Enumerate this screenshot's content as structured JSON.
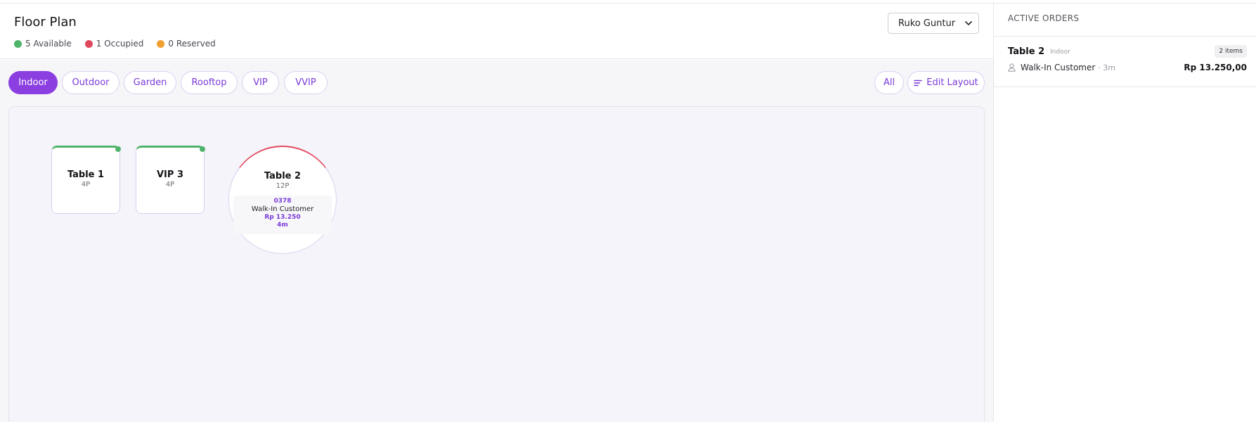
{
  "header": {
    "title": "Floor Plan",
    "legend": [
      {
        "label": "5 Available",
        "color": "#4fb46a"
      },
      {
        "label": "1 Occupied",
        "color": "#e0475d"
      },
      {
        "label": "0 Reserved",
        "color": "#f0a030"
      }
    ],
    "outlet": {
      "selected": "Ruko Guntur"
    }
  },
  "areas": {
    "tabs": [
      {
        "label": "Indoor",
        "active": true
      },
      {
        "label": "Outdoor",
        "active": false
      },
      {
        "label": "Garden",
        "active": false
      },
      {
        "label": "Rooftop",
        "active": false
      },
      {
        "label": "VIP",
        "active": false
      },
      {
        "label": "VVIP",
        "active": false
      }
    ],
    "all_label": "All",
    "edit_label": "Edit Layout"
  },
  "tables": [
    {
      "name": "Table 1",
      "capacity": "4P",
      "status": "available"
    },
    {
      "name": "VIP 3",
      "capacity": "4P",
      "status": "available"
    },
    {
      "name": "Table 2",
      "capacity": "12P",
      "status": "occupied",
      "order": {
        "code": "0378",
        "customer": "Walk-In Customer",
        "amount": "Rp 13.250",
        "elapsed": "4m"
      }
    }
  ],
  "side_panel": {
    "title": "ACTIVE ORDERS",
    "orders": [
      {
        "table": "Table 2",
        "area": "Indoor",
        "items": "2 items",
        "customer": "Walk-In Customer",
        "age": "· 3m",
        "amount": "Rp 13.250,00"
      }
    ]
  },
  "colors": {
    "accent": "#8b3fe0",
    "available": "#4fb46a",
    "occupied": "#e0475d",
    "reserved": "#f0a030"
  }
}
